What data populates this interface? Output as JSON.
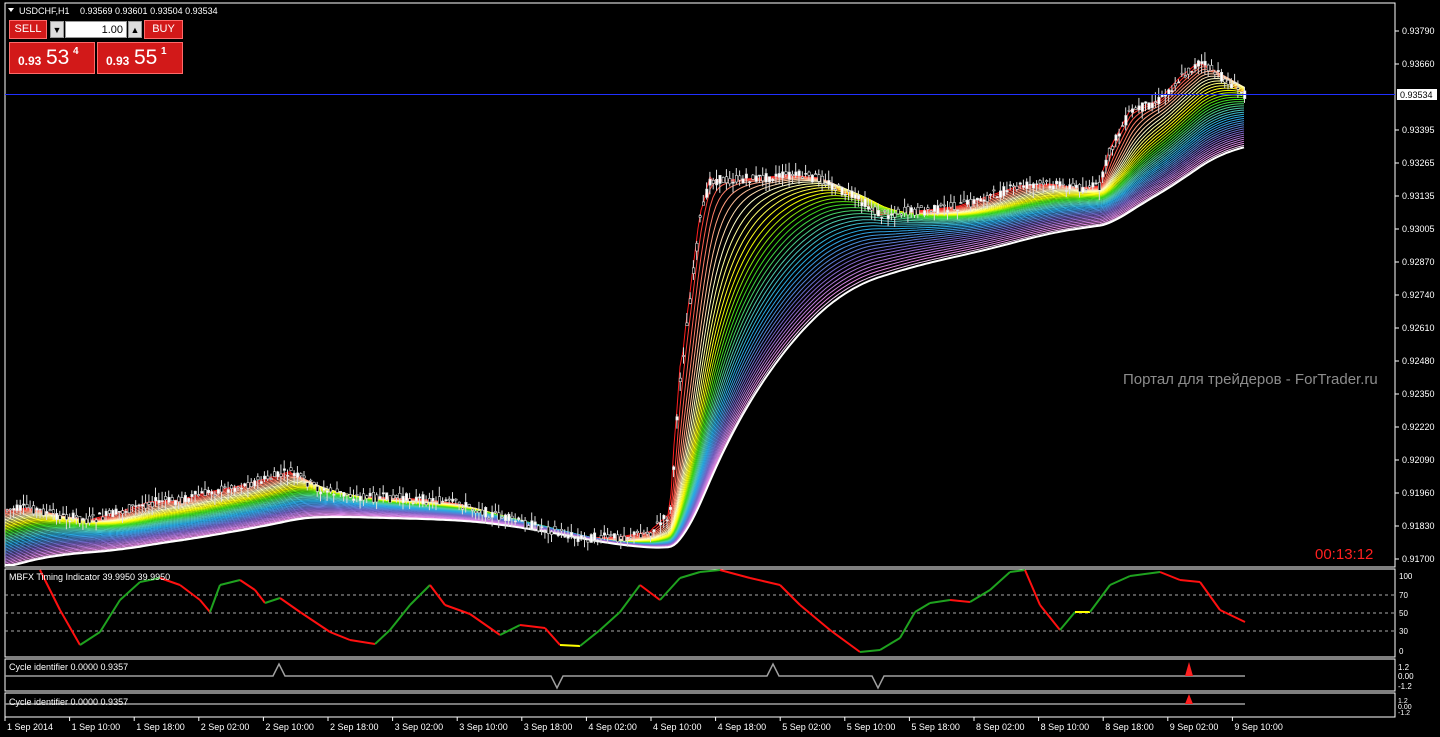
{
  "header": {
    "symbol": "USDCHF,H1",
    "ohlc": "0.93569 0.93601 0.93504 0.93534"
  },
  "trade_panel": {
    "sell_label": "SELL",
    "buy_label": "BUY",
    "lot_value": "1.00",
    "sell_price_small": "0.93",
    "sell_price_big": "53",
    "sell_price_sup": "4",
    "buy_price_small": "0.93",
    "buy_price_big": "55",
    "buy_price_sup": "1",
    "arrow_down": "▼",
    "arrow_up": "▲"
  },
  "price_axis": [
    "0.93790",
    "0.93660",
    "0.93534",
    "0.93395",
    "0.93265",
    "0.93135",
    "0.93005",
    "0.92870",
    "0.92740",
    "0.92610",
    "0.92480",
    "0.92350",
    "0.92220",
    "0.92090",
    "0.91960",
    "0.91830",
    "0.91700"
  ],
  "current_price": "0.93534",
  "watermark": "Портал для трейдеров - ForTrader.ru",
  "timer": "00:13:12",
  "indicator1": {
    "title": "MBFX Timing Indicator 39.9950 39.9950",
    "levels": [
      "100",
      "70",
      "50",
      "30",
      "0"
    ]
  },
  "indicator2": {
    "title": "Cycle identifier 0.0000 0.9357",
    "levels": [
      "1.2",
      "0.00",
      "-1.2"
    ]
  },
  "indicator3": {
    "title": "Cycle identifier 0.0000 0.9357",
    "levels": [
      "1.2",
      "0.00",
      "-1.2"
    ]
  },
  "time_axis": [
    "1 Sep 2014",
    "1 Sep 10:00",
    "1 Sep 18:00",
    "2 Sep 02:00",
    "2 Sep 10:00",
    "2 Sep 18:00",
    "3 Sep 02:00",
    "3 Sep 10:00",
    "3 Sep 18:00",
    "4 Sep 02:00",
    "4 Sep 10:00",
    "4 Sep 18:00",
    "5 Sep 02:00",
    "5 Sep 10:00",
    "5 Sep 18:00",
    "8 Sep 02:00",
    "8 Sep 10:00",
    "8 Sep 18:00",
    "9 Sep 02:00",
    "9 Sep 10:00"
  ],
  "colors": {
    "background": "#000000",
    "border": "#ffffff",
    "price_line": "#2030ff",
    "timer": "#ff2020",
    "watermark": "#8c8c8c",
    "osc_up": "#1fa21f",
    "osc_down": "#ff1010",
    "osc_turn": "#ffff00",
    "cycle": "#a0a0a0",
    "cycle_marker": "#ff2020",
    "candle_up": "#ffffff",
    "candle_down": "#000000"
  }
}
